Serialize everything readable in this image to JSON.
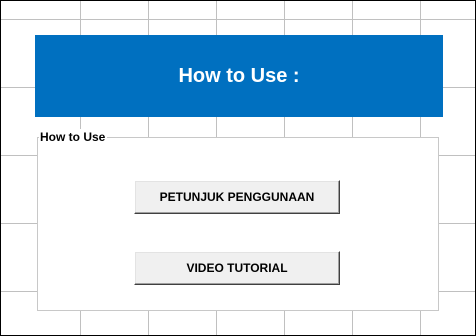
{
  "colors": {
    "header_bg": "#0070c0",
    "grid_line": "#c0c0c0",
    "window_bg": "#ffffff"
  },
  "header": {
    "title": "How to Use :"
  },
  "group": {
    "label": "How to Use",
    "buttons": {
      "guide_label": "PETUNJUK PENGGUNAAN",
      "video_label": "VIDEO TUTORIAL"
    }
  }
}
